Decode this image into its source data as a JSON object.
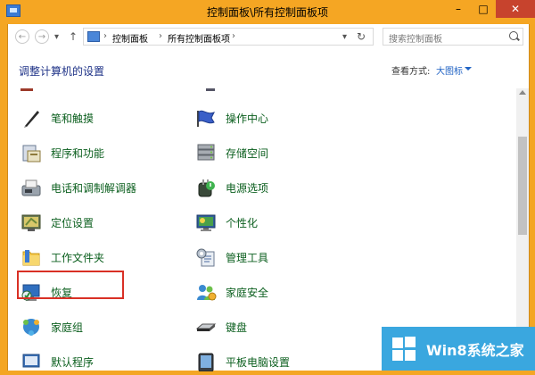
{
  "window": {
    "title": "控制面板\\所有控制面板项",
    "minimize_glyph": "–",
    "maximize_glyph": "□",
    "close_glyph": "✕"
  },
  "address": {
    "crumb_root": "控制面板",
    "crumb_sep": "›",
    "crumb_current": "所有控制面板项",
    "search_placeholder": "搜索控制面板"
  },
  "header": {
    "title": "调整计算机的设置",
    "view_by_label": "查看方式:",
    "view_by_value": "大图标"
  },
  "items": [
    {
      "label": "笔和触摸",
      "icon": "pen-icon"
    },
    {
      "label": "操作中心",
      "icon": "flag-icon"
    },
    {
      "label": "程序和功能",
      "icon": "programs-icon"
    },
    {
      "label": "存储空间",
      "icon": "storage-icon"
    },
    {
      "label": "电话和调制解调器",
      "icon": "fax-icon"
    },
    {
      "label": "电源选项",
      "icon": "power-icon"
    },
    {
      "label": "定位设置",
      "icon": "location-icon",
      "selected": true
    },
    {
      "label": "个性化",
      "icon": "personalization-icon"
    },
    {
      "label": "工作文件夹",
      "icon": "folder-icon"
    },
    {
      "label": "管理工具",
      "icon": "admin-tools-icon"
    },
    {
      "label": "恢复",
      "icon": "recovery-icon"
    },
    {
      "label": "家庭安全",
      "icon": "family-safety-icon"
    },
    {
      "label": "家庭组",
      "icon": "homegroup-icon"
    },
    {
      "label": "键盘",
      "icon": "keyboard-icon"
    },
    {
      "label": "默认程序",
      "icon": "default-programs-icon"
    },
    {
      "label": "平板电脑设置",
      "icon": "tablet-icon"
    }
  ],
  "watermark": {
    "text": "Win8系统之家"
  },
  "colors": {
    "titlebar": "#f5a623",
    "link_green": "#0b5f1e",
    "header_blue": "#1e3287",
    "selection_red": "#d93025",
    "watermark_blue": "#3aa7df"
  }
}
